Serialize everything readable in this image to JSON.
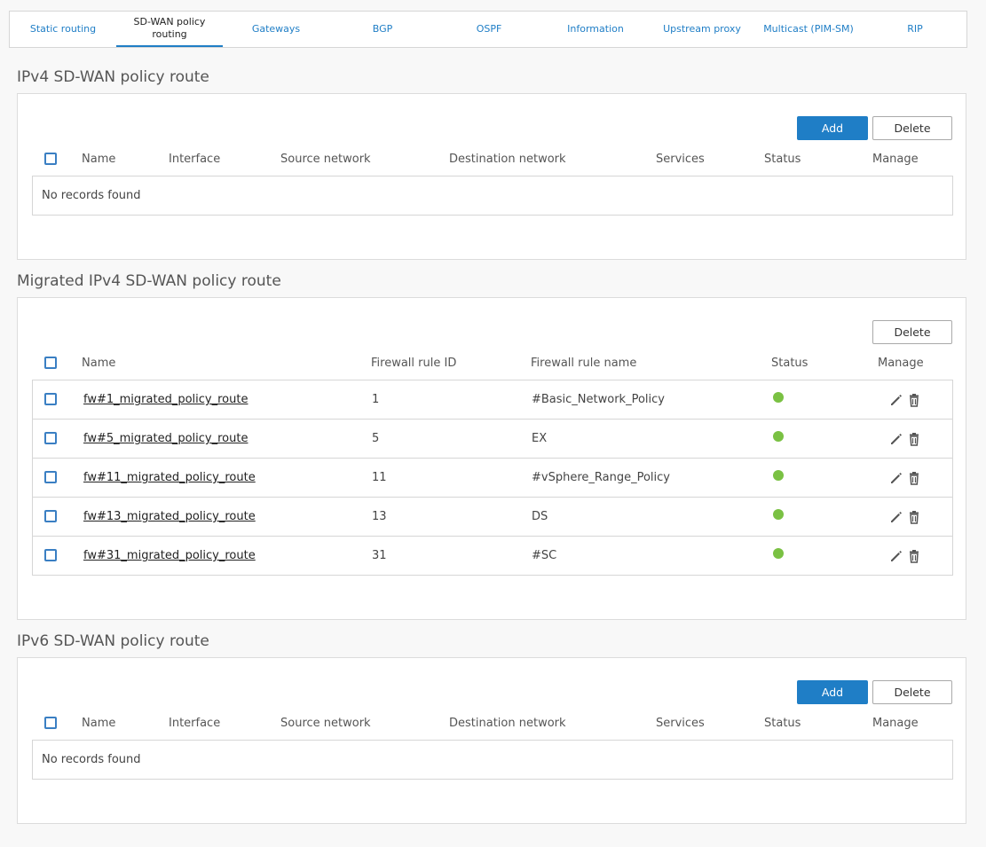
{
  "tabs": [
    {
      "label": "Static routing"
    },
    {
      "label": "SD-WAN policy routing"
    },
    {
      "label": "Gateways"
    },
    {
      "label": "BGP"
    },
    {
      "label": "OSPF"
    },
    {
      "label": "Information"
    },
    {
      "label": "Upstream proxy"
    },
    {
      "label": "Multicast (PIM-SM)"
    },
    {
      "label": "RIP"
    }
  ],
  "active_tab": "SD-WAN policy routing",
  "ipv4": {
    "title": "IPv4 SD-WAN policy route",
    "add_label": "Add",
    "delete_label": "Delete",
    "columns": [
      "Name",
      "Interface",
      "Source network",
      "Destination network",
      "Services",
      "Status",
      "Manage"
    ],
    "empty": "No records found"
  },
  "migrated": {
    "title": "Migrated IPv4 SD-WAN policy route",
    "delete_label": "Delete",
    "columns": [
      "Name",
      "Firewall rule ID",
      "Firewall rule name",
      "Status",
      "Manage"
    ],
    "rows": [
      {
        "name": "fw#1_migrated_policy_route",
        "id": "1",
        "rule": "#Basic_Network_Policy",
        "status": "active"
      },
      {
        "name": "fw#5_migrated_policy_route",
        "id": "5",
        "rule": "EX",
        "status": "active"
      },
      {
        "name": "fw#11_migrated_policy_route",
        "id": "11",
        "rule": "#vSphere_Range_Policy",
        "status": "active"
      },
      {
        "name": "fw#13_migrated_policy_route",
        "id": "13",
        "rule": "DS",
        "status": "active"
      },
      {
        "name": "fw#31_migrated_policy_route",
        "id": "31",
        "rule": "#SC",
        "status": "active"
      }
    ]
  },
  "ipv6": {
    "title": "IPv6 SD-WAN policy route",
    "add_label": "Add",
    "delete_label": "Delete",
    "columns": [
      "Name",
      "Interface",
      "Source network",
      "Destination network",
      "Services",
      "Status",
      "Manage"
    ],
    "empty": "No records found"
  },
  "colors": {
    "accent": "#1f7ec6",
    "status_active": "#7ac143",
    "icon": "#555555"
  },
  "icons": {
    "edit": "pencil-icon",
    "delete": "trash-icon"
  }
}
